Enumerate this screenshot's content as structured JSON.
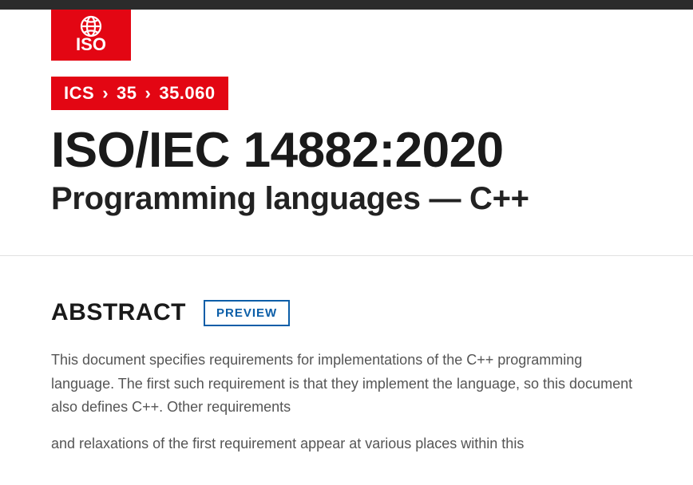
{
  "breadcrumb": {
    "label_root": "ICS",
    "level1": "35",
    "level2": "35.060"
  },
  "standard": {
    "code": "ISO/IEC 14882:2020",
    "title": "Programming languages — C++"
  },
  "abstract": {
    "heading": "ABSTRACT",
    "preview_label": "PREVIEW",
    "paragraph1": "This document specifies requirements for implementations of the C++ programming language. The first such requirement is that they implement the language, so this document also defines C++. Other requirements",
    "paragraph2": "and relaxations of the first requirement appear at various places within this"
  }
}
